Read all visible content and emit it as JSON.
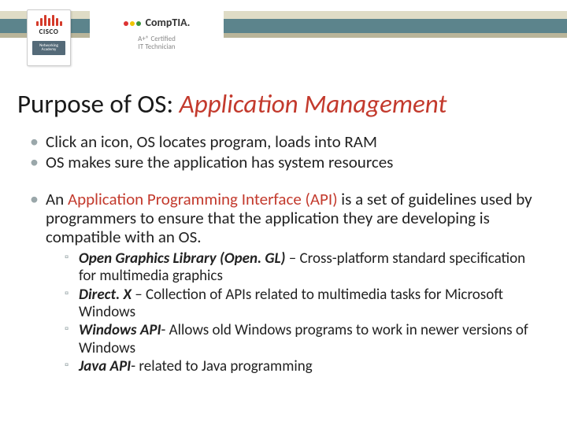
{
  "logos": {
    "cisco_word": "CISCO",
    "cisco_sub": "Networking Academy",
    "comptia_text": "CompTIA.",
    "comptia_sub1": "A+® Certified",
    "comptia_sub2": "IT Technician"
  },
  "title": {
    "prefix": "Purpose of OS: ",
    "emphasis": "Application Management"
  },
  "bullets": {
    "b1": "Click an icon, OS locates program, loads into RAM",
    "b2": "OS makes sure the application has system resources",
    "b3_pre": "An ",
    "b3_red": "Application Programming Interface (API)",
    "b3_post": " is a set of guidelines used by programmers to ensure that the application they are developing is compatible with an OS."
  },
  "sub": {
    "s1_name": "Open Graphics Library (Open. GL)",
    "s1_sep": " – ",
    "s1_desc": "Cross-platform standard specification for multimedia graphics",
    "s2_name": "Direct. X",
    "s2_sep": " – ",
    "s2_desc": "Collection of APIs related to multimedia tasks for Microsoft Windows",
    "s3_name": "Windows API",
    "s3_sep": "- ",
    "s3_desc": "Allows old Windows programs to work in newer versions of Windows",
    "s4_name": "Java API",
    "s4_sep": "- ",
    "s4_desc": "related to Java programming"
  }
}
